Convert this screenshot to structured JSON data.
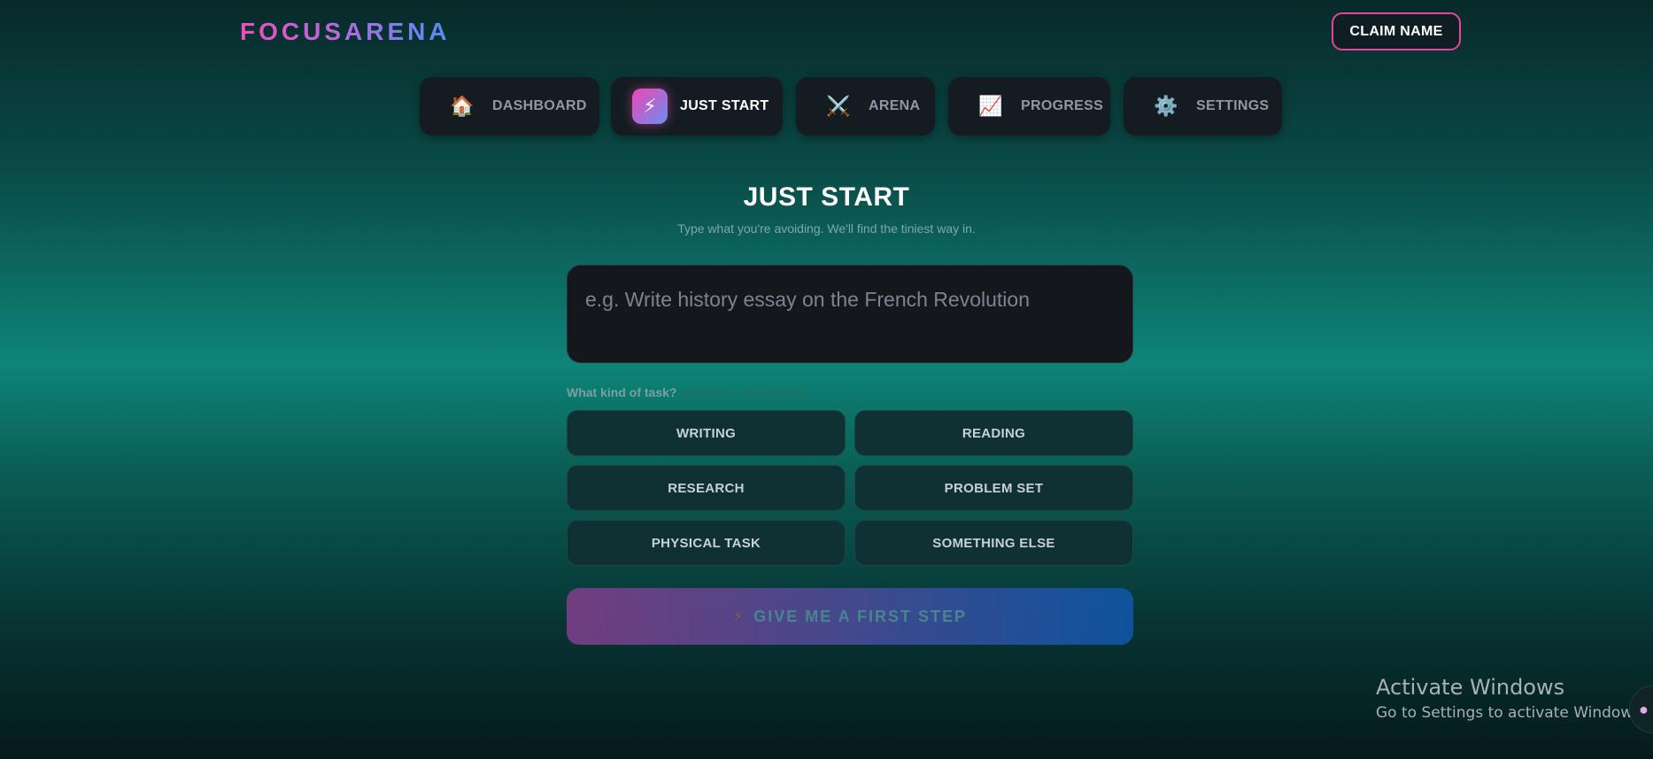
{
  "header": {
    "logo": "FOCUSARENA",
    "claim_button": "CLAIM NAME"
  },
  "nav": {
    "items": [
      {
        "label": "DASHBOARD",
        "icon": "house-icon",
        "glyph": "🏠",
        "active": false
      },
      {
        "label": "JUST START",
        "icon": "lightning-icon",
        "glyph": "⚡",
        "active": true
      },
      {
        "label": "ARENA",
        "icon": "crossed-swords-icon",
        "glyph": "⚔️",
        "active": false
      },
      {
        "label": "PROGRESS",
        "icon": "chart-icon",
        "glyph": "📈",
        "active": false
      },
      {
        "label": "SETTINGS",
        "icon": "gear-icon",
        "glyph": "⚙️",
        "active": false
      }
    ]
  },
  "main": {
    "title": "JUST START",
    "subtitle": "Type what you're avoiding. We'll find the tiniest way in.",
    "task_input": {
      "value": "",
      "placeholder": "e.g. Write history essay on the French Revolution"
    },
    "kind_label": "What kind of task?",
    "kind_hint": "optional — we'll guess",
    "task_types": [
      "WRITING",
      "READING",
      "RESEARCH",
      "PROBLEM SET",
      "PHYSICAL TASK",
      "SOMETHING ELSE"
    ],
    "first_step_button": "GIVE ME A FIRST STEP"
  },
  "os_overlay": {
    "title": "Activate Windows",
    "subtitle": "Go to Settings to activate Windows."
  },
  "colors": {
    "accent_pink": "#ec4fb7",
    "accent_blue": "#4f8ef0",
    "card_bg": "#141c22",
    "chip_bg": "#0f3133"
  }
}
